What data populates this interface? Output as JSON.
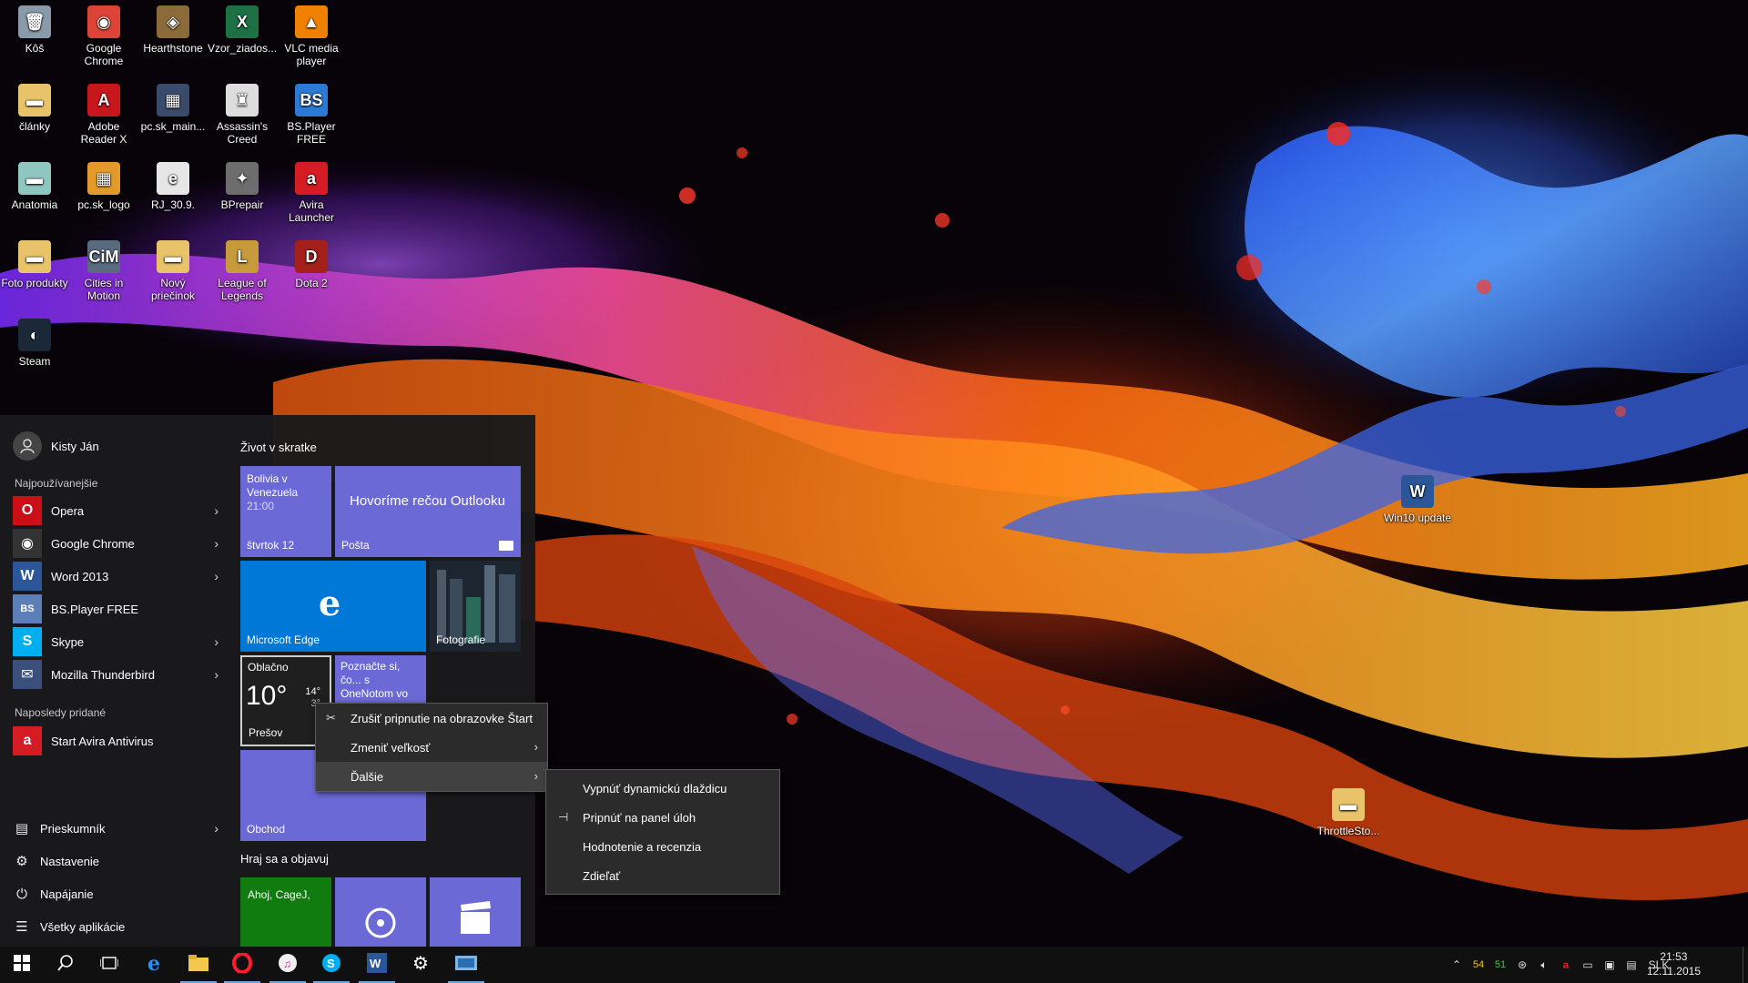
{
  "desktop_icons": [
    {
      "label": "Kôš",
      "icon": "recycle-bin-icon",
      "color": "#8a9aa8"
    },
    {
      "label": "Google Chrome",
      "icon": "chrome-icon",
      "color": "#db4437"
    },
    {
      "label": "Hearthstone",
      "icon": "hearthstone-icon",
      "color": "#8b6b3a"
    },
    {
      "label": "Vzor_ziados...",
      "icon": "excel-file-icon",
      "color": "#1e7145"
    },
    {
      "label": "VLC media player",
      "icon": "vlc-icon",
      "color": "#f08000"
    },
    {
      "label": "články",
      "icon": "folder-icon",
      "color": "#e8c36a"
    },
    {
      "label": "Adobe Reader X",
      "icon": "adobe-reader-icon",
      "color": "#c8161d"
    },
    {
      "label": "pc.sk_main...",
      "icon": "image-file-icon",
      "color": "#3a4a6a"
    },
    {
      "label": "Assassin's Creed",
      "icon": "assassins-creed-icon",
      "color": "#dddddd"
    },
    {
      "label": "BS.Player FREE",
      "icon": "bsplayer-icon",
      "color": "#2b7bd6"
    },
    {
      "label": "Anatomia",
      "icon": "folder-icon",
      "color": "#8fc6c0"
    },
    {
      "label": "pc.sk_logo",
      "icon": "image-file-icon",
      "color": "#e39a2a"
    },
    {
      "label": "RJ_30.9.",
      "icon": "pdf-file-icon",
      "color": "#e6e6e6"
    },
    {
      "label": "BPrepair",
      "icon": "bprepair-icon",
      "color": "#6d6d6d"
    },
    {
      "label": "Avira Launcher",
      "icon": "avira-icon",
      "color": "#d51c24"
    },
    {
      "label": "Foto produkty",
      "icon": "folder-icon",
      "color": "#e8c36a"
    },
    {
      "label": "Cities in Motion",
      "icon": "cities-in-motion-icon",
      "color": "#5a6b80"
    },
    {
      "label": "Nový priečinok",
      "icon": "folder-icon",
      "color": "#e8c36a"
    },
    {
      "label": "League of Legends",
      "icon": "league-of-legends-icon",
      "color": "#c79b3b"
    },
    {
      "label": "Dota 2",
      "icon": "dota2-icon",
      "color": "#a3201b"
    },
    {
      "label": "Steam",
      "icon": "steam-icon",
      "color": "#1b2838"
    }
  ],
  "desktop_icons_right": [
    {
      "label": "Win10 update",
      "icon": "word-file-icon",
      "color": "#2b579a"
    },
    {
      "label": "ThrottleSto...",
      "icon": "folder-icon",
      "color": "#e8c36a"
    }
  ],
  "start_menu": {
    "user_name": "Kisty Ján",
    "most_used_label": "Najpoužívanejšie",
    "most_used": [
      {
        "label": "Opera",
        "icon": "opera-icon",
        "color": "#cc0f16",
        "glyph": "O",
        "has_arrow": true
      },
      {
        "label": "Google Chrome",
        "icon": "chrome-icon",
        "color": "#333333",
        "glyph": "◉",
        "has_arrow": true
      },
      {
        "label": "Word 2013",
        "icon": "word-icon",
        "color": "#2b579a",
        "glyph": "W",
        "has_arrow": true
      },
      {
        "label": "BS.Player FREE",
        "icon": "bsplayer-icon",
        "color": "#5d7fb8",
        "glyph": "BS",
        "has_arrow": false
      },
      {
        "label": "Skype",
        "icon": "skype-icon",
        "color": "#00aff0",
        "glyph": "S",
        "has_arrow": true
      },
      {
        "label": "Mozilla Thunderbird",
        "icon": "thunderbird-icon",
        "color": "#3a4f7a",
        "glyph": "✉",
        "has_arrow": true
      }
    ],
    "recently_added_label": "Naposledy pridané",
    "recently_added": [
      {
        "label": "Start Avira Antivirus",
        "icon": "avira-icon",
        "color": "#d51c24",
        "glyph": "a"
      }
    ],
    "system_items": [
      {
        "label": "Prieskumník",
        "icon": "file-explorer-icon",
        "glyph": "▤",
        "has_arrow": true
      },
      {
        "label": "Nastavenie",
        "icon": "settings-icon",
        "glyph": "⚙",
        "has_arrow": false
      },
      {
        "label": "Napájanie",
        "icon": "power-icon",
        "glyph": "⏻",
        "has_arrow": false
      },
      {
        "label": "Všetky aplikácie",
        "icon": "all-apps-icon",
        "glyph": "☰",
        "has_arrow": false
      }
    ],
    "group1_title": "Život v skratke",
    "group2_title": "Hraj sa a objavuj",
    "tiles": {
      "calendar": {
        "line1": "Bolivia v",
        "line2": "Venezuela",
        "time": "21:00",
        "label": "štvrtok 12",
        "color": "#6b69d6"
      },
      "mail": {
        "headline": "Hovoríme rečou Outlooku",
        "label": "Pošta",
        "color": "#6b69d6"
      },
      "edge": {
        "label": "Microsoft Edge",
        "glyph": "e",
        "color": "#0078d7"
      },
      "photos": {
        "label": "Fotografie",
        "color": "#2b3540"
      },
      "weather": {
        "condition": "Oblačno",
        "temp": "10°",
        "high": "14°",
        "low": "3°",
        "label": "Prešov",
        "color": "#1f1f1f"
      },
      "onenote": {
        "text": "Poznačte si, čo... s OneNotom vo svojom telefóne",
        "color": "#6b69d6"
      },
      "store": {
        "label": "Obchod",
        "color": "#6b69d6"
      },
      "xbox": {
        "text": "Ahoj, CageJ,",
        "color": "#107c10"
      },
      "groove": {
        "color": "#6b69d6"
      },
      "movies": {
        "color": "#6b69d6"
      }
    }
  },
  "context_menu": {
    "items": [
      {
        "label": "Zrušiť pripnutie na obrazovke Štart",
        "icon": "unpin-icon",
        "has_submenu": false
      },
      {
        "label": "Zmeniť veľkosť",
        "icon": "",
        "has_submenu": true
      },
      {
        "label": "Ďalšie",
        "icon": "",
        "has_submenu": true
      }
    ]
  },
  "submenu": {
    "items": [
      {
        "label": "Vypnúť dynamickú dlaždicu",
        "icon": ""
      },
      {
        "label": "Pripnúť na panel úloh",
        "icon": "pin-icon"
      },
      {
        "label": "Hodnotenie a recenzia",
        "icon": ""
      },
      {
        "label": "Zdieľať",
        "icon": ""
      }
    ]
  },
  "taskbar": {
    "apps": [
      {
        "name": "start-button",
        "icon": "windows-logo-icon"
      },
      {
        "name": "search-button",
        "icon": "search-icon"
      },
      {
        "name": "task-view-button",
        "icon": "task-view-icon"
      },
      {
        "name": "edge-taskbar-button",
        "icon": "edge-icon"
      },
      {
        "name": "explorer-taskbar-button",
        "icon": "folder-icon"
      },
      {
        "name": "opera-taskbar-button",
        "icon": "opera-icon"
      },
      {
        "name": "itunes-taskbar-button",
        "icon": "itunes-icon"
      },
      {
        "name": "skype-taskbar-button",
        "icon": "skype-icon"
      },
      {
        "name": "word-taskbar-button",
        "icon": "word-icon"
      },
      {
        "name": "settings-taskbar-button",
        "icon": "gear-icon"
      },
      {
        "name": "remote-desktop-taskbar-button",
        "icon": "monitor-icon"
      }
    ],
    "tray": {
      "cpu_temp": "54",
      "gpu_temp": "51",
      "language": "SLK",
      "time": "21:53",
      "date": "12.11.2015"
    }
  }
}
